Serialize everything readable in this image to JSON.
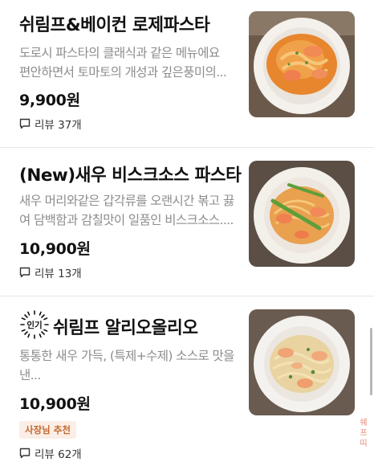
{
  "menu": {
    "items": [
      {
        "title": "쉬림프&베이컨 로제파스타",
        "desc_lines": [
          "도로시 파스타의 클래식과 같은 메뉴에요",
          "편안하면서 토마토의 개성과 깊은풍미의..."
        ],
        "price": "9,900원",
        "review": "리뷰 37개",
        "image": "rose-pasta-photo"
      },
      {
        "title": "(New)새우 비스크소스 파스타",
        "desc_lines": [
          "새우 머리와같은 갑각류를 오랜시간 볶고 끓",
          "여 담백함과 감칠맛이 일품인 비스크소스...."
        ],
        "price": "10,900원",
        "review": "리뷰 13개",
        "image": "bisque-pasta-photo"
      },
      {
        "popular_badge": "인기",
        "title": "쉬림프 알리오올리오",
        "desc_lines": [
          "통통한 새우 가득, (특제+수제) 소스로 맛을",
          "낸..."
        ],
        "price": "10,900원",
        "owner_badge": "사장님 추천",
        "review": "리뷰 62개",
        "image": "aglio-olio-photo"
      }
    ]
  },
  "watermark": "쉐프띠",
  "colors": {
    "price": "#111111",
    "desc": "#8c8c8c",
    "divider": "#e6e6e6",
    "owner_badge_bg": "#fbeee6",
    "owner_badge_text": "#c2692f"
  },
  "icons": [
    "comment-icon",
    "popular-starburst-icon"
  ]
}
